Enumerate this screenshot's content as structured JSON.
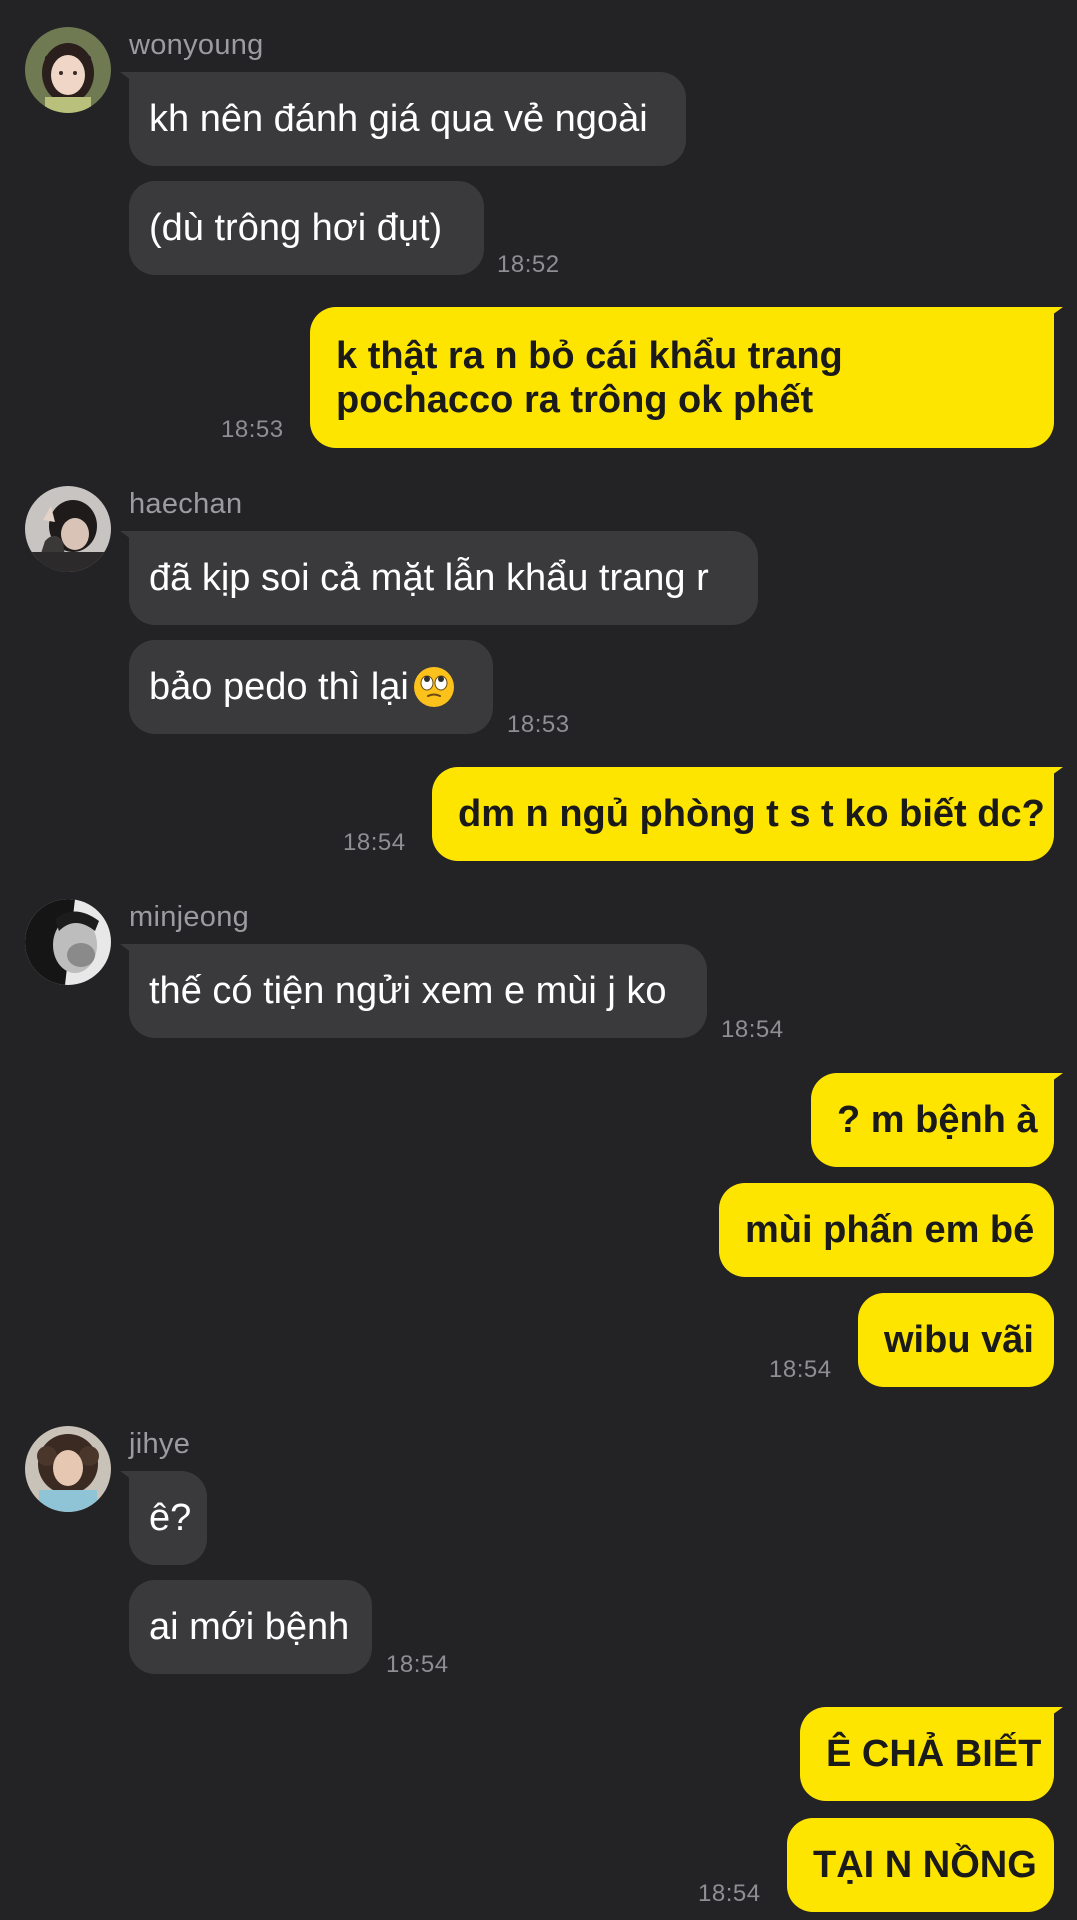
{
  "colors": {
    "background": "#232325",
    "incoming_bubble": "#3a3a3c",
    "outgoing_bubble": "#fee500",
    "sender_name": "#9b9ba0",
    "timestamp": "#8e8e93"
  },
  "messages": {
    "g1": {
      "sender": "wonyoung",
      "m1": "kh nên đánh giá qua vẻ ngoài",
      "m2": "(dù trông hơi đụt)",
      "time": "18:52"
    },
    "o1": {
      "m1": "k thật ra n bỏ cái khẩu trang pochacco ra trông ok phết",
      "time": "18:53"
    },
    "g2": {
      "sender": "haechan",
      "m1": "đã kịp soi cả mặt lẫn khẩu trang r",
      "m2": "bảo pedo thì lại",
      "m2_emoji": "face-with-rolling-eyes-emoji",
      "time": "18:53"
    },
    "o2": {
      "m1": "dm n ngủ phòng t s t ko biết dc?",
      "time": "18:54"
    },
    "g3": {
      "sender": "minjeong",
      "m1": "thế có tiện ngửi xem e mùi j ko",
      "time": "18:54"
    },
    "o3": {
      "m1": "? m bệnh à",
      "m2": "mùi phấn em bé",
      "m3": "wibu vãi",
      "time": "18:54"
    },
    "g4": {
      "sender": "jihye",
      "m1": "ê?",
      "m2": "ai mới bệnh",
      "time": "18:54"
    },
    "o4": {
      "m1": "Ê CHẢ BIẾT",
      "m2": "TẠI N NỒNG",
      "time": "18:54"
    }
  }
}
